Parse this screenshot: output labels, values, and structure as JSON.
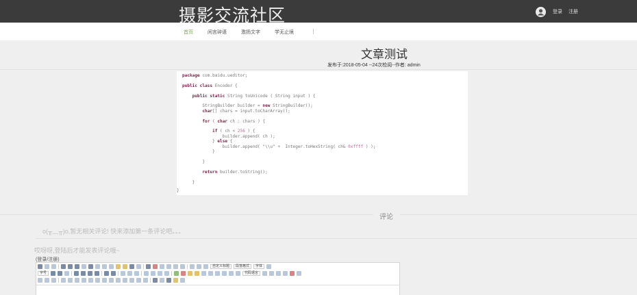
{
  "header": {
    "site_title": "摄影交流社区",
    "login": "登录",
    "register": "注册"
  },
  "nav": {
    "items": [
      "首页",
      "闲言碎语",
      "激扬文字",
      "学无止境"
    ],
    "active_index": 0
  },
  "article": {
    "title": "文章测试",
    "meta": "发布于:2018-05-04 --24次检阅--作者: admin"
  },
  "code": {
    "lines": [
      [
        {
          "t": "package",
          "k": "kw"
        },
        {
          "t": " com.baidu.ueditor;"
        }
      ],
      [
        {
          "t": ""
        }
      ],
      [
        {
          "t": "public class",
          "k": "kw"
        },
        {
          "t": " Encoder {"
        }
      ],
      [
        {
          "t": ""
        }
      ],
      [
        {
          "t": "    "
        },
        {
          "t": "public static",
          "k": "kw"
        },
        {
          "t": " String toUnicode ( String input ) {"
        }
      ],
      [
        {
          "t": ""
        }
      ],
      [
        {
          "t": "        StringBuilder builder = "
        },
        {
          "t": "new",
          "k": "kw"
        },
        {
          "t": " StringBuilder();"
        }
      ],
      [
        {
          "t": "        "
        },
        {
          "t": "char",
          "k": "kw"
        },
        {
          "t": "[] chars = input.toCharArray();"
        }
      ],
      [
        {
          "t": ""
        }
      ],
      [
        {
          "t": "        "
        },
        {
          "t": "for",
          "k": "kw"
        },
        {
          "t": " ( "
        },
        {
          "t": "char",
          "k": "kw"
        },
        {
          "t": " ch : chars ) {"
        }
      ],
      [
        {
          "t": ""
        }
      ],
      [
        {
          "t": "            "
        },
        {
          "t": "if",
          "k": "kw"
        },
        {
          "t": " ( ch < "
        },
        {
          "t": "256",
          "k": "num"
        },
        {
          "t": " ) {"
        }
      ],
      [
        {
          "t": "                builder.append( ch );"
        }
      ],
      [
        {
          "t": "            } "
        },
        {
          "t": "else",
          "k": "kw"
        },
        {
          "t": " {"
        }
      ],
      [
        {
          "t": "                builder.append( \"\\\\u\" +  Integer.toHexString( ch& "
        },
        {
          "t": "0xffff",
          "k": "num"
        },
        {
          "t": " ) );"
        }
      ],
      [
        {
          "t": "            }"
        }
      ],
      [
        {
          "t": ""
        }
      ],
      [
        {
          "t": "        }"
        }
      ],
      [
        {
          "t": ""
        }
      ],
      [
        {
          "t": "        "
        },
        {
          "t": "return",
          "k": "kw"
        },
        {
          "t": " builder.toString();"
        }
      ],
      [
        {
          "t": ""
        }
      ],
      [
        {
          "t": "    }"
        }
      ]
    ],
    "closing": "}"
  },
  "comments": {
    "heading": "评论",
    "empty_text": "o(╥﹏╥)o,暂无相关评论! 快来添加第一条评论吧。。。",
    "login_prompt": "哎呀呀,登陆后才能发表评论哦~",
    "login_register": "(登录/注册)"
  },
  "editor": {
    "selects": {
      "custom_title": "自定义标题",
      "paragraph_format": "段落格式",
      "font_family": "字体",
      "font_size": "字号",
      "code_language": "代码语言"
    }
  }
}
